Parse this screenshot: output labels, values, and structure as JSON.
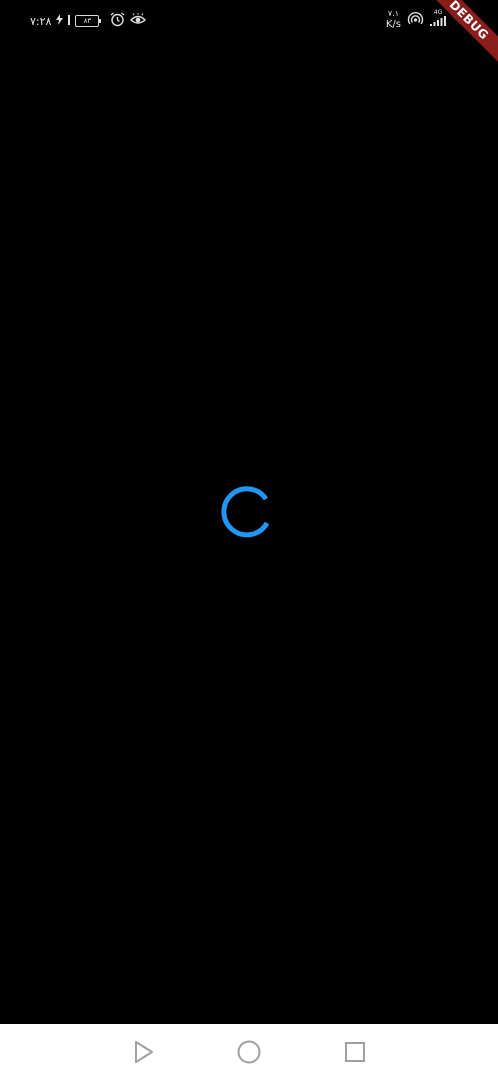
{
  "status_bar": {
    "time": "۷:۲۸",
    "battery_level": "۸۳",
    "speed_value": "۷.۱",
    "speed_unit": "K/s",
    "network_type": "4G",
    "icons": [
      "charging-icon",
      "alarm-icon",
      "eye-comfort-icon",
      "hotspot-icon",
      "signal-icon",
      "wifi-icon"
    ]
  },
  "debug_banner": {
    "label": "DEBUG",
    "color": "#8b1c1c"
  },
  "loading": {
    "color": "#2196f3"
  },
  "nav_bar": {
    "icons": [
      "back-triangle-icon",
      "home-circle-icon",
      "recents-square-icon"
    ]
  }
}
